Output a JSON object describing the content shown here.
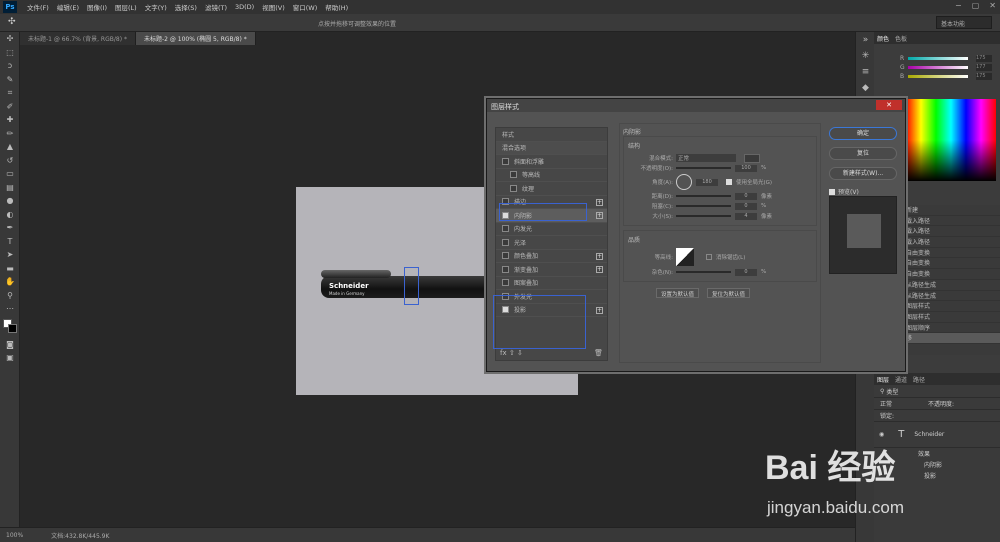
{
  "app": {
    "logo": "Ps"
  },
  "menu": [
    "文件(F)",
    "编辑(E)",
    "图像(I)",
    "图层(L)",
    "文字(Y)",
    "选择(S)",
    "滤镜(T)",
    "3D(D)",
    "视图(V)",
    "窗口(W)",
    "帮助(H)"
  ],
  "window_controls": [
    "−",
    "▢",
    "✕"
  ],
  "options": {
    "hint": "点按并拖移可调整效果的位置",
    "workspace": "基本功能"
  },
  "tabs": [
    "未标题-1 @ 66.7% (背景, RGB/8) *",
    "未标题-2 @ 100% (椭圆 5, RGB/8) *"
  ],
  "canvas": {
    "brand": "Schneider",
    "made": "Made in Germany"
  },
  "status": {
    "zoom": "100%",
    "doc": "文档:432.8K/445.9K"
  },
  "colors": {
    "accent": "#3a62d0",
    "close": "#c0302b",
    "background": "#282828"
  },
  "color_panel": {
    "tabs": [
      "颜色",
      "色板"
    ],
    "labels": [
      "R",
      "G",
      "B"
    ],
    "values": [
      "175",
      "177",
      "175"
    ]
  },
  "history": {
    "items": [
      "新建",
      "载入路径",
      "载入路径",
      "载入路径",
      "自由变换",
      "自由变换",
      "自由变换",
      "从路径生成",
      "从路径生成",
      "图层样式",
      "图层样式",
      "图层顺序",
      "移"
    ]
  },
  "layers": {
    "tabs": [
      "图层",
      "通道",
      "路径"
    ],
    "filter_label": "类型",
    "blend": "正常",
    "opacity_label": "不透明度:",
    "lock_label": "锁定:",
    "layer_name": "Schneider",
    "sublabels": [
      "效果",
      "内阴影",
      "投影"
    ]
  },
  "dialog": {
    "title": "图层样式",
    "close": "✕",
    "list": [
      "样式",
      "混合选项",
      "斜面和浮雕",
      "等高线",
      "纹理",
      "描边",
      "内阴影",
      "内发光",
      "光泽",
      "颜色叠加",
      "渐变叠加",
      "图案叠加",
      "外发光",
      "投影"
    ],
    "section": "内阴影",
    "structure": "结构",
    "blend_label": "混合模式:",
    "blend_value": "正常",
    "opacity_label": "不透明度(O):",
    "opacity_value": "100",
    "angle_label": "角度(A):",
    "angle_value": "180",
    "global_light": "使用全局光(G)",
    "distance_label": "距离(D):",
    "distance_value": "0",
    "choke_label": "阻塞(C):",
    "choke_value": "0",
    "size_label": "大小(S):",
    "size_value": "4",
    "unit_px": "像素",
    "unit_pct": "%",
    "quality": "品质",
    "contour_label": "等高线:",
    "antialias": "消除锯齿(L)",
    "noise_label": "杂色(N):",
    "noise_value": "0",
    "default_set": "设置为默认值",
    "default_reset": "复位为默认值",
    "ok": "确定",
    "reset": "复位",
    "new_style": "新建样式(W)...",
    "preview": "预览(V)"
  },
  "watermark": {
    "main": "Bai 经验",
    "url": "jingyan.baidu.com"
  }
}
